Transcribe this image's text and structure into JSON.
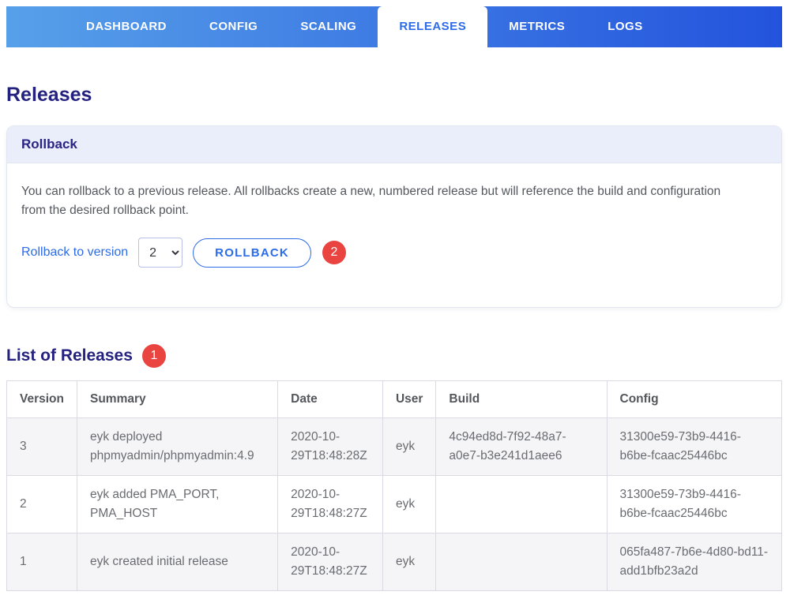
{
  "nav": {
    "tabs": [
      {
        "label": "DASHBOARD",
        "active": false
      },
      {
        "label": "CONFIG",
        "active": false
      },
      {
        "label": "SCALING",
        "active": false
      },
      {
        "label": "RELEASES",
        "active": true
      },
      {
        "label": "METRICS",
        "active": false
      },
      {
        "label": "LOGS",
        "active": false
      }
    ]
  },
  "page": {
    "title": "Releases"
  },
  "rollback_panel": {
    "header": "Rollback",
    "description": "You can rollback to a previous release. All rollbacks create a new, numbered release but will reference the build and configuration from the desired rollback point.",
    "version_label": "Rollback to version",
    "selected_version": "2",
    "button_label": "ROLLBACK",
    "annotation_badge": "2"
  },
  "releases_section": {
    "title": "List of Releases",
    "annotation_badge": "1",
    "table": {
      "columns": [
        "Version",
        "Summary",
        "Date",
        "User",
        "Build",
        "Config"
      ],
      "rows": [
        [
          "3",
          "eyk deployed phpmyadmin/phpmyadmin:4.9",
          "2020-10-29T18:48:28Z",
          "eyk",
          "4c94ed8d-7f92-48a7-a0e7-b3e241d1aee6",
          "31300e59-73b9-4416-b6be-fcaac25446bc"
        ],
        [
          "2",
          "eyk added PMA_PORT, PMA_HOST",
          "2020-10-29T18:48:27Z",
          "eyk",
          "",
          "31300e59-73b9-4416-b6be-fcaac25446bc"
        ],
        [
          "1",
          "eyk created initial release",
          "2020-10-29T18:48:27Z",
          "eyk",
          "",
          "065fa487-7b6e-4d80-bd11-add1bfb23a2d"
        ]
      ]
    }
  },
  "colors": {
    "nav_gradient_start": "#57a0e9",
    "nav_gradient_end": "#2353dd",
    "accent_blue": "#2c6be9",
    "heading_navy": "#25227f",
    "badge_red": "#e94440",
    "panel_header_bg": "#e9eefa",
    "row_stripe": "#f5f5f8"
  }
}
